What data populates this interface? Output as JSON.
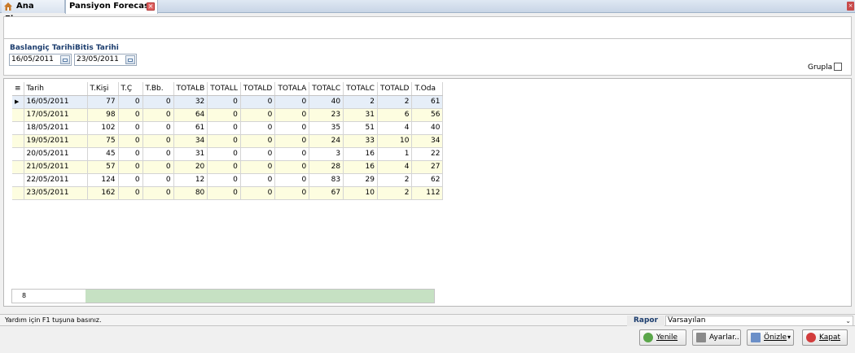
{
  "tabs": {
    "home_label": "Ana Ekran",
    "active_label": "Pansiyon Forecast"
  },
  "filters": {
    "start_label": "Baslangiç Tarihi",
    "start_value": "16/05/2011",
    "end_label": "Bitis Tarihi",
    "end_value": "23/05/2011",
    "group_label": "Grupla"
  },
  "grid": {
    "columns": [
      "Tarih",
      "T.Kişi",
      "T.Ç",
      "T.Bb.",
      "TOTALB",
      "TOTALL",
      "TOTALD",
      "TOTALA",
      "TOTALC",
      "TOTALC",
      "TOTALD",
      "T.Oda"
    ],
    "rows": [
      [
        "16/05/2011",
        "77",
        "0",
        "0",
        "32",
        "0",
        "0",
        "0",
        "40",
        "2",
        "2",
        "61"
      ],
      [
        "17/05/2011",
        "98",
        "0",
        "0",
        "64",
        "0",
        "0",
        "0",
        "23",
        "31",
        "6",
        "56"
      ],
      [
        "18/05/2011",
        "102",
        "0",
        "0",
        "61",
        "0",
        "0",
        "0",
        "35",
        "51",
        "4",
        "40"
      ],
      [
        "19/05/2011",
        "75",
        "0",
        "0",
        "34",
        "0",
        "0",
        "0",
        "24",
        "33",
        "10",
        "34"
      ],
      [
        "20/05/2011",
        "45",
        "0",
        "0",
        "31",
        "0",
        "0",
        "0",
        "3",
        "16",
        "1",
        "22"
      ],
      [
        "21/05/2011",
        "57",
        "0",
        "0",
        "20",
        "0",
        "0",
        "0",
        "28",
        "16",
        "4",
        "27"
      ],
      [
        "22/05/2011",
        "124",
        "0",
        "0",
        "12",
        "0",
        "0",
        "0",
        "83",
        "29",
        "2",
        "62"
      ],
      [
        "23/05/2011",
        "162",
        "0",
        "0",
        "80",
        "0",
        "0",
        "0",
        "67",
        "10",
        "2",
        "112"
      ]
    ],
    "row_count": "8"
  },
  "status": {
    "help_text": "Yardım için F1 tuşuna basınız.",
    "rapor_label": "Rapor",
    "rapor_value": "Varsayılan"
  },
  "buttons": {
    "refresh_label": "Yenile",
    "settings_label": "Ayarlar..",
    "preview_label": "Önizle",
    "close_label": "Kapat"
  },
  "colors": {
    "accent": "#1c3d6e",
    "alt_row": "#fdfde0",
    "summary_bar": "#c6e1c3"
  }
}
